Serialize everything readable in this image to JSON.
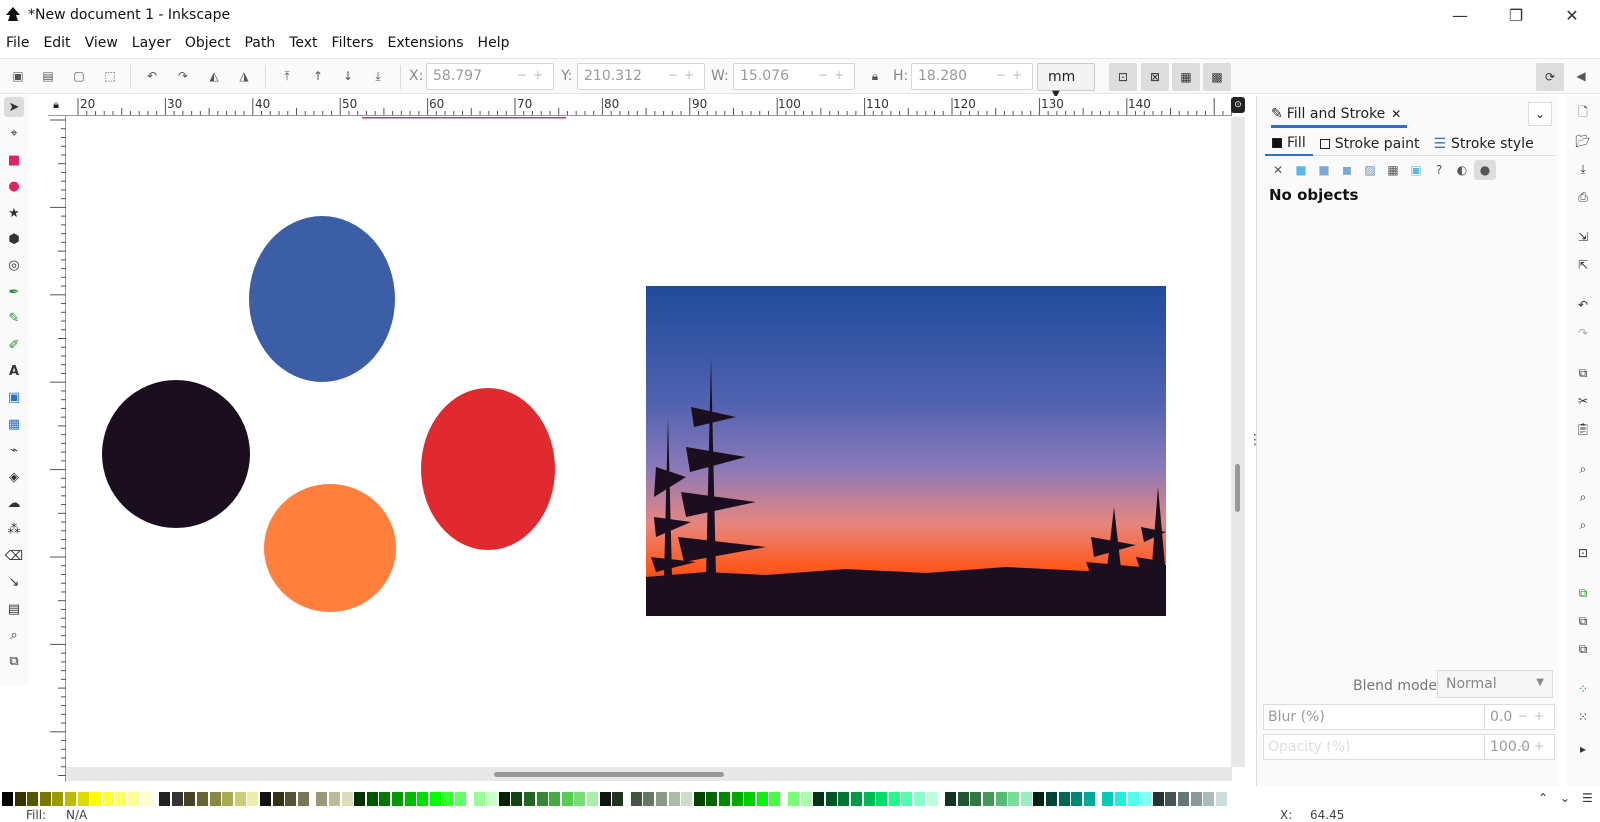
{
  "window": {
    "title": "*New document 1 - Inkscape"
  },
  "window_controls": {
    "minimize": "—",
    "restore": "❐",
    "close": "✕"
  },
  "menu": [
    "File",
    "Edit",
    "View",
    "Layer",
    "Object",
    "Path",
    "Text",
    "Filters",
    "Extensions",
    "Help"
  ],
  "toolbar": {
    "x_label": "X:",
    "x_value": "58.797",
    "y_label": "Y:",
    "y_value": "210.312",
    "w_label": "W:",
    "w_value": "15.076",
    "h_label": "H:",
    "h_value": "18.280",
    "unit": "mm"
  },
  "ruler": {
    "labels": [
      "20",
      "30",
      "40",
      "50",
      "60",
      "70",
      "80",
      "90",
      "100",
      "110",
      "120",
      "130",
      "140"
    ]
  },
  "canvas": {
    "shapes": [
      {
        "name": "blue-ellipse",
        "color": "#3b5ea6"
      },
      {
        "name": "dark-circle",
        "color": "#1b0f1f"
      },
      {
        "name": "red-ellipse",
        "color": "#e02a2f"
      },
      {
        "name": "orange-circle",
        "color": "#ff7f3c"
      }
    ],
    "image_name": "sunset-photo"
  },
  "dock": {
    "tab_label": "Fill and Stroke",
    "subtabs": {
      "fill": "Fill",
      "stroke_paint": "Stroke paint",
      "stroke_style": "Stroke style"
    },
    "message": "No objects",
    "blend_label": "Blend mode:",
    "blend_value": "Normal",
    "blur_label": "Blur (%)",
    "blur_value": "0.0",
    "opacity_label": "Opacity (%)",
    "opacity_value": "100.0"
  },
  "statusbar": {
    "fill_label": "Fill:",
    "fill_value": "N/A",
    "x_label": "X:",
    "x_value": "64.45"
  },
  "palette_colors": [
    "#000000",
    "#333300",
    "#555500",
    "#777700",
    "#999900",
    "#bbbb00",
    "#dddd00",
    "#ffff00",
    "#ffff33",
    "#ffff66",
    "#ffff99",
    "#ffffcc",
    "#222222",
    "#333333",
    "#444422",
    "#666633",
    "#888844",
    "#aaaa55",
    "#cccc77",
    "#eeeeaa",
    "#111111",
    "#333311",
    "#555533",
    "#777755",
    "#999977",
    "#bbbb99",
    "#ddddbb",
    "#003300",
    "#005500",
    "#007700",
    "#009900",
    "#00bb00",
    "#00dd00",
    "#00ff00",
    "#33ff33",
    "#66ff66",
    "#99ff99",
    "#ccffcc",
    "#002200",
    "#114411",
    "#226622",
    "#338833",
    "#44aa44",
    "#55cc55",
    "#77dd77",
    "#aaeeaa",
    "#111511",
    "#223322",
    "#445544",
    "#667766",
    "#889988",
    "#aabbaa",
    "#ccddcc",
    "#004400",
    "#006600",
    "#008800",
    "#00aa00",
    "#00cc00",
    "#11ee11",
    "#44ff44",
    "#77ff77",
    "#aaffaa",
    "#003311",
    "#005522",
    "#007733",
    "#009944",
    "#00bb55",
    "#00dd66",
    "#22ff88",
    "#55ffaa",
    "#88ffcc",
    "#bbffdd",
    "#113322",
    "#225533",
    "#337744",
    "#449955",
    "#55bb77",
    "#77dd99",
    "#99eebb",
    "#002211",
    "#004433",
    "#006655",
    "#008877",
    "#00aa99",
    "#00ccbb",
    "#22eedd",
    "#55ffee",
    "#88fff5",
    "#223333",
    "#445555",
    "#667777",
    "#889999",
    "#aabbbb",
    "#ccdddd"
  ]
}
